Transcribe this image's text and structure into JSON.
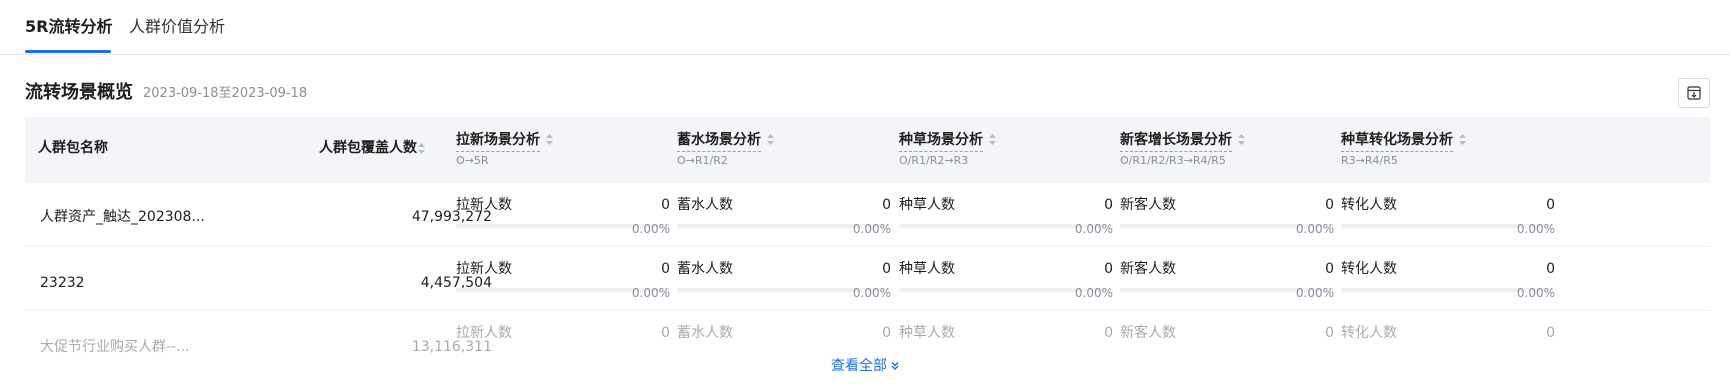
{
  "tabs": [
    {
      "label": "5R流转分析",
      "active": true
    },
    {
      "label": "人群价值分析",
      "active": false
    }
  ],
  "section": {
    "title": "流转场景概览",
    "date_range": "2023-09-18至2023-09-18"
  },
  "table": {
    "headers": {
      "name": "人群包名称",
      "coverage": "人群包覆盖人数",
      "scenes": [
        {
          "title": "拉新场景分析",
          "sub": "O→5R"
        },
        {
          "title": "蓄水场景分析",
          "sub": "O→R1/R2"
        },
        {
          "title": "种草场景分析",
          "sub": "O/R1/R2→R3"
        },
        {
          "title": "新客增长场景分析",
          "sub": "O/R1/R2/R3→R4/R5"
        },
        {
          "title": "种草转化场景分析",
          "sub": "R3→R4/R5"
        }
      ]
    },
    "rows": [
      {
        "name": "人群资产_触达_202308...",
        "coverage": "47,993,272",
        "metrics": [
          {
            "label": "拉新人数",
            "value": "0",
            "pct": "0.00%",
            "fraction": 0
          },
          {
            "label": "蓄水人数",
            "value": "0",
            "pct": "0.00%",
            "fraction": 0
          },
          {
            "label": "种草人数",
            "value": "0",
            "pct": "0.00%",
            "fraction": 0
          },
          {
            "label": "新客人数",
            "value": "0",
            "pct": "0.00%",
            "fraction": 0
          },
          {
            "label": "转化人数",
            "value": "0",
            "pct": "0.00%",
            "fraction": 0
          }
        ]
      },
      {
        "name": "23232",
        "coverage": "4,457,504",
        "metrics": [
          {
            "label": "拉新人数",
            "value": "0",
            "pct": "0.00%",
            "fraction": 0
          },
          {
            "label": "蓄水人数",
            "value": "0",
            "pct": "0.00%",
            "fraction": 0
          },
          {
            "label": "种草人数",
            "value": "0",
            "pct": "0.00%",
            "fraction": 0
          },
          {
            "label": "新客人数",
            "value": "0",
            "pct": "0.00%",
            "fraction": 0
          },
          {
            "label": "转化人数",
            "value": "0",
            "pct": "0.00%",
            "fraction": 0
          }
        ]
      },
      {
        "name": "大促节行业购买人群--...",
        "coverage": "13,116,311",
        "metrics": [
          {
            "label": "拉新人数",
            "value": "0",
            "fraction": 0
          },
          {
            "label": "蓄水人数",
            "value": "0",
            "fraction": 0
          },
          {
            "label": "种草人数",
            "value": "0",
            "fraction": 0
          },
          {
            "label": "新客人数",
            "value": "0",
            "fraction": 0
          },
          {
            "label": "转化人数",
            "value": "0",
            "fraction": 0
          }
        ]
      }
    ]
  },
  "view_all": "查看全部",
  "colors": {
    "accent": "#1f6cf0",
    "header_bg": "#f3f5f8",
    "muted_text": "#8a8f99"
  },
  "icons": {
    "export": "download-box-icon",
    "sort": "sort-caret-icon",
    "expand": "double-chevron-down-icon"
  }
}
